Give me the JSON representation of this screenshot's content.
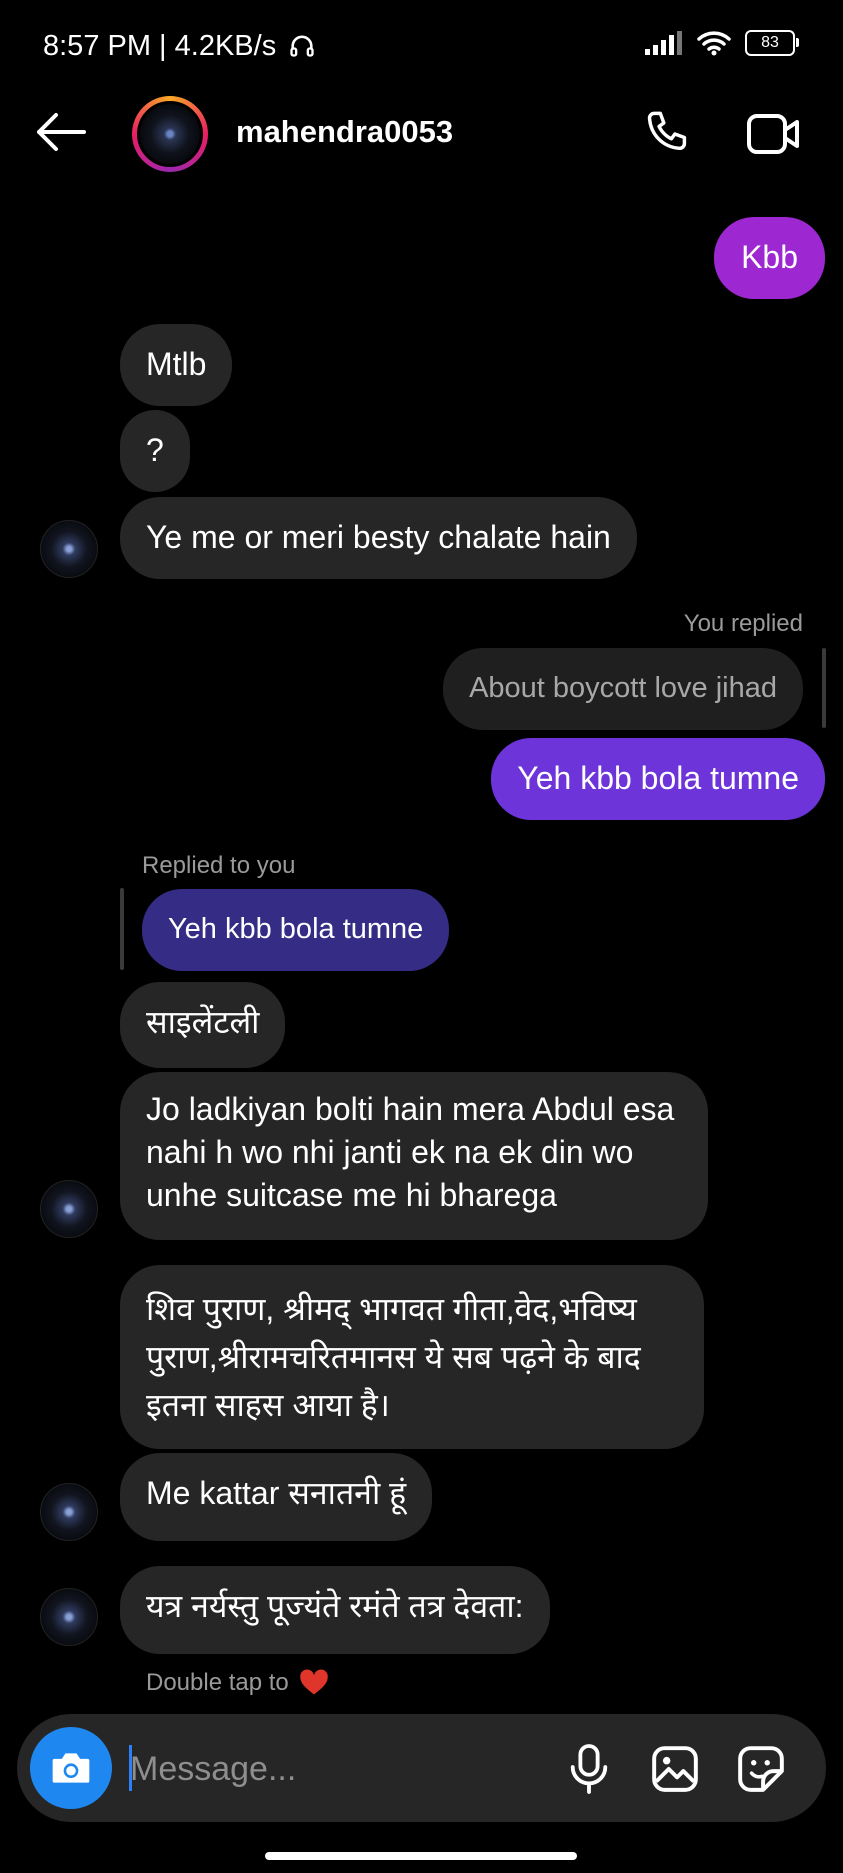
{
  "status_bar": {
    "time_speed": "8:57 PM | 4.2KB/s",
    "battery": "83"
  },
  "header": {
    "username": "mahendra0053"
  },
  "messages": {
    "m1": "Kbb",
    "m2": "Mtlb",
    "m3": "?",
    "m4": "Ye me or meri besty chalate hain",
    "you_replied_label": "You replied",
    "m5_quote": "About boycott love jihad",
    "m5": "Yeh kbb bola tumne",
    "replied_to_you_label": "Replied to you",
    "m6_quote": "Yeh kbb bola tumne",
    "m6": "साइलेंटली",
    "m7": "Jo ladkiyan bolti hain mera Abdul esa nahi h wo nhi janti ek na ek din wo unhe suitcase me hi bharega",
    "m8": "शिव पुराण, श्रीमद् भागवत गीता,वेद,भविष्य पुराण,श्रीरामचरितमानस ये सब पढ़ने के बाद इतना साहस आया है।",
    "m9": "Me kattar सनातनी हूं",
    "m10": "यत्र नर्यस्तु पूज्यंते रमंते तत्र देवता:",
    "double_tap_hint": "Double tap to"
  },
  "composer": {
    "placeholder": "Message..."
  },
  "colors": {
    "accent_blue": "#1e88f0",
    "bubble_incoming": "#262626",
    "bubble_outgoing_purple": "#9d27d0",
    "bubble_outgoing_indigo": "#6d35d9"
  },
  "icons": [
    "back-arrow-icon",
    "phone-icon",
    "video-camera-icon",
    "camera-icon",
    "microphone-icon",
    "gallery-icon",
    "sticker-icon",
    "heart-icon",
    "signal-icon",
    "wifi-icon",
    "headphones-icon"
  ]
}
